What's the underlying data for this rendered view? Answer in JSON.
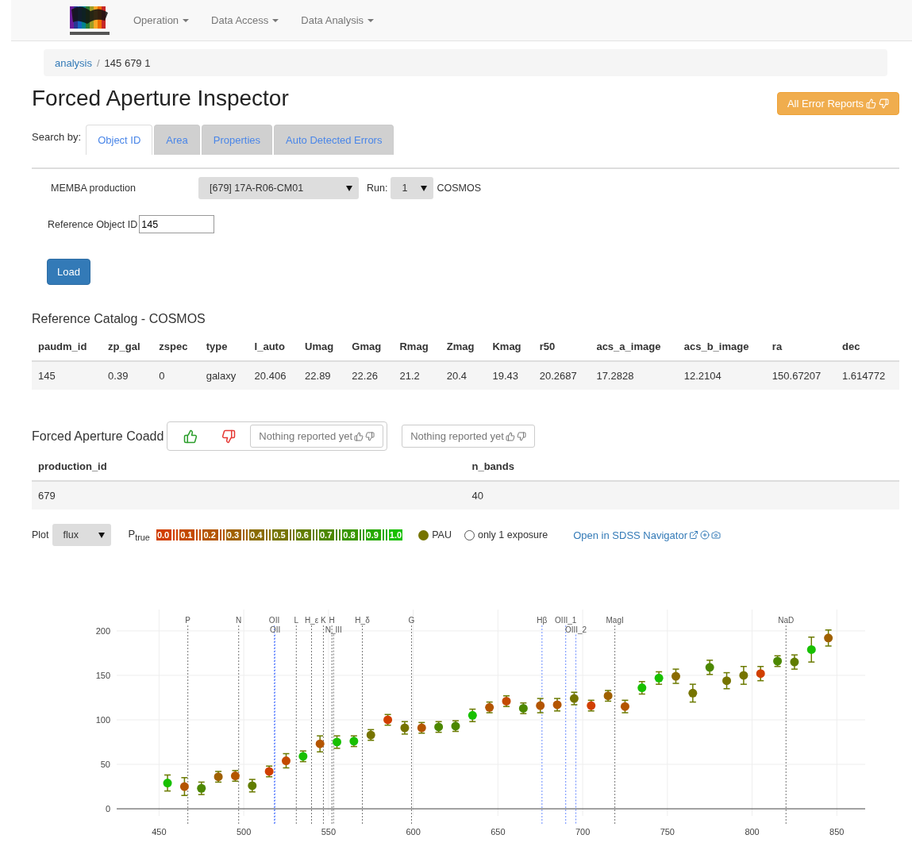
{
  "navbar": {
    "menus": [
      {
        "label": "Operation"
      },
      {
        "label": "Data Access"
      },
      {
        "label": "Data Analysis"
      }
    ]
  },
  "breadcrumb": [
    {
      "label": "analysis",
      "kind": "link",
      "separator": "/"
    },
    {
      "label": "145 679 1",
      "kind": "current"
    }
  ],
  "title": "Forced Aperture Inspector",
  "error_reports_button": "All Error Reports",
  "search": {
    "label": "Search by:",
    "tabs": [
      {
        "label": "Object ID",
        "selected": true
      },
      {
        "label": "Area",
        "selected": false
      },
      {
        "label": "Properties",
        "selected": false
      },
      {
        "label": "Auto Detected Errors",
        "selected": false
      }
    ]
  },
  "form": {
    "production_label": "MEMBA production",
    "production_value": "[679] 17A-R06-CM01",
    "run_label": "Run:",
    "run_value": "1",
    "catalog": "COSMOS",
    "ref_label": "Reference Object ID",
    "ref_value": "145",
    "load": "Load"
  },
  "reference_catalog": {
    "title": "Reference Catalog - COSMOS",
    "columns": [
      "paudm_id",
      "zp_gal",
      "zspec",
      "type",
      "I_auto",
      "Umag",
      "Gmag",
      "Rmag",
      "Zmag",
      "Kmag",
      "r50",
      "acs_a_image",
      "acs_b_image",
      "ra",
      "dec"
    ],
    "rows": [
      [
        "145",
        "0.39",
        "0",
        "galaxy",
        "20.406",
        "22.89",
        "22.26",
        "21.2",
        "20.4",
        "19.43",
        "20.2687",
        "17.2828",
        "12.2104",
        "150.67207",
        "1.614772"
      ]
    ]
  },
  "coadd": {
    "title": "Forced Aperture Coadd",
    "feedback": [
      "Nothing reported yet",
      "Nothing reported yet"
    ],
    "columns": [
      "production_id",
      "n_bands"
    ],
    "rows": [
      [
        "679",
        "40"
      ]
    ]
  },
  "plot_controls": {
    "label": "Plot",
    "value": "flux",
    "p_label": "P$_{true}$",
    "legend": {
      "label": "PAU",
      "color": "#767400"
    },
    "exposure": {
      "label": "only 1 exposure",
      "checked": false
    },
    "link": "Open in SDSS Navigator"
  },
  "chart_data": {
    "type": "scatter",
    "grid": true,
    "xlim": [
      425,
      870
    ],
    "ylim": [
      -8,
      224
    ],
    "xticks": [
      450,
      500,
      550,
      600,
      650,
      700,
      750,
      800,
      850
    ],
    "yticks": [
      0,
      50,
      100,
      150,
      200
    ],
    "x": [
      455,
      465,
      475,
      485,
      495,
      505,
      515,
      525,
      535,
      545,
      555,
      565,
      575,
      585,
      595,
      605,
      615,
      625,
      635,
      645,
      655,
      665,
      675,
      685,
      695,
      705,
      715,
      725,
      735,
      745,
      755,
      765,
      775,
      785,
      795,
      805,
      815,
      825,
      835,
      845
    ],
    "series": [
      {
        "name": "0.0",
        "color": "#d13f00",
        "values": [
          null,
          null,
          null,
          null,
          null,
          null,
          42,
          null,
          null,
          null,
          null,
          null,
          null,
          100,
          null,
          null,
          null,
          null,
          null,
          null,
          null,
          null,
          null,
          null,
          null,
          116,
          null,
          null,
          null,
          null,
          null,
          null,
          null,
          null,
          null,
          152,
          null,
          null,
          null,
          null
        ],
        "errors": [
          null,
          null,
          null,
          null,
          null,
          null,
          6,
          null,
          null,
          null,
          null,
          null,
          null,
          6,
          null,
          null,
          null,
          null,
          null,
          null,
          null,
          null,
          null,
          null,
          null,
          6,
          null,
          null,
          null,
          null,
          null,
          null,
          null,
          null,
          null,
          8,
          null,
          null,
          null,
          null
        ]
      },
      {
        "name": "0.1",
        "color": "#c44a00",
        "values": [
          null,
          null,
          null,
          null,
          null,
          null,
          null,
          54,
          null,
          null,
          null,
          null,
          null,
          null,
          null,
          null,
          null,
          null,
          null,
          null,
          121,
          null,
          null,
          null,
          null,
          null,
          null,
          null,
          null,
          null,
          null,
          null,
          null,
          null,
          null,
          null,
          null,
          null,
          null,
          null
        ],
        "errors": [
          null,
          null,
          null,
          null,
          null,
          null,
          null,
          8,
          null,
          null,
          null,
          null,
          null,
          null,
          null,
          null,
          null,
          null,
          null,
          null,
          6,
          null,
          null,
          null,
          null,
          null,
          null,
          null,
          null,
          null,
          null,
          null,
          null,
          null,
          null,
          null,
          null,
          null,
          null,
          null
        ]
      },
      {
        "name": "0.2",
        "color": "#b45500",
        "values": [
          null,
          25,
          null,
          null,
          37,
          null,
          null,
          null,
          null,
          73,
          null,
          null,
          null,
          null,
          null,
          91,
          null,
          null,
          null,
          114,
          null,
          null,
          116,
          117,
          null,
          null,
          null,
          115,
          null,
          null,
          null,
          null,
          null,
          null,
          null,
          null,
          null,
          null,
          null,
          null
        ],
        "errors": [
          null,
          10,
          null,
          null,
          6,
          null,
          null,
          null,
          null,
          9,
          null,
          null,
          null,
          null,
          null,
          6,
          null,
          null,
          null,
          6,
          null,
          null,
          8,
          7,
          null,
          null,
          null,
          7,
          null,
          null,
          null,
          null,
          null,
          null,
          null,
          null,
          null,
          null,
          null,
          null
        ]
      },
      {
        "name": "0.3",
        "color": "#a06000",
        "values": [
          null,
          null,
          null,
          36,
          null,
          null,
          null,
          null,
          null,
          null,
          null,
          null,
          null,
          null,
          null,
          null,
          null,
          null,
          null,
          null,
          null,
          null,
          null,
          null,
          null,
          null,
          127,
          null,
          null,
          null,
          null,
          null,
          null,
          null,
          null,
          null,
          null,
          null,
          null,
          192
        ],
        "errors": [
          null,
          null,
          null,
          6,
          null,
          null,
          null,
          null,
          null,
          null,
          null,
          null,
          null,
          null,
          null,
          null,
          null,
          null,
          null,
          null,
          null,
          null,
          null,
          null,
          null,
          null,
          6,
          null,
          null,
          null,
          null,
          null,
          null,
          null,
          null,
          null,
          null,
          null,
          null,
          9
        ]
      },
      {
        "name": "0.4",
        "color": "#8a6b00",
        "values": [
          null,
          null,
          null,
          null,
          null,
          null,
          null,
          null,
          null,
          null,
          null,
          null,
          null,
          null,
          null,
          null,
          null,
          null,
          null,
          null,
          null,
          null,
          null,
          null,
          null,
          null,
          null,
          null,
          null,
          null,
          149,
          null,
          null,
          null,
          null,
          null,
          null,
          null,
          null,
          null
        ],
        "errors": [
          null,
          null,
          null,
          null,
          null,
          null,
          null,
          null,
          null,
          null,
          null,
          null,
          null,
          null,
          null,
          null,
          null,
          null,
          null,
          null,
          null,
          null,
          null,
          null,
          null,
          null,
          null,
          null,
          null,
          null,
          8,
          null,
          null,
          null,
          null,
          null,
          null,
          null,
          null,
          null
        ]
      },
      {
        "name": "0.5",
        "color": "#767400",
        "values": [
          null,
          null,
          null,
          null,
          null,
          null,
          null,
          null,
          null,
          null,
          null,
          null,
          83,
          null,
          91,
          null,
          null,
          null,
          null,
          null,
          null,
          null,
          null,
          null,
          124,
          null,
          null,
          null,
          null,
          null,
          null,
          130,
          null,
          144,
          150,
          null,
          null,
          null,
          null,
          null
        ],
        "errors": [
          null,
          null,
          null,
          null,
          null,
          null,
          null,
          null,
          null,
          null,
          null,
          null,
          6,
          null,
          7,
          null,
          null,
          null,
          null,
          null,
          null,
          null,
          null,
          null,
          7,
          null,
          null,
          null,
          null,
          null,
          null,
          10,
          null,
          9,
          10,
          null,
          null,
          null,
          null,
          null
        ]
      },
      {
        "name": "0.6",
        "color": "#617d00",
        "values": [
          null,
          null,
          null,
          null,
          null,
          26,
          null,
          null,
          null,
          null,
          null,
          null,
          null,
          null,
          null,
          null,
          null,
          null,
          null,
          null,
          null,
          null,
          null,
          null,
          null,
          null,
          null,
          null,
          null,
          null,
          null,
          null,
          null,
          null,
          null,
          null,
          null,
          165,
          null,
          null
        ],
        "errors": [
          null,
          null,
          null,
          null,
          null,
          7,
          null,
          null,
          null,
          null,
          null,
          null,
          null,
          null,
          null,
          null,
          null,
          null,
          null,
          null,
          null,
          null,
          null,
          null,
          null,
          null,
          null,
          null,
          null,
          null,
          null,
          null,
          null,
          null,
          null,
          null,
          null,
          8,
          null,
          null
        ]
      },
      {
        "name": "0.7",
        "color": "#4c8800",
        "values": [
          null,
          null,
          23,
          null,
          null,
          null,
          null,
          null,
          null,
          null,
          null,
          null,
          null,
          null,
          null,
          null,
          92,
          93,
          null,
          null,
          null,
          113,
          null,
          null,
          null,
          null,
          null,
          null,
          null,
          null,
          null,
          null,
          159,
          null,
          null,
          null,
          166,
          null,
          null,
          null
        ],
        "errors": [
          null,
          null,
          7,
          null,
          null,
          null,
          null,
          null,
          null,
          null,
          null,
          null,
          null,
          null,
          null,
          null,
          6,
          6,
          null,
          null,
          null,
          6,
          null,
          null,
          null,
          null,
          null,
          null,
          null,
          null,
          null,
          null,
          8,
          null,
          null,
          null,
          6,
          null,
          null,
          null
        ]
      },
      {
        "name": "0.8",
        "color": "#389600",
        "values": [
          null,
          null,
          null,
          null,
          null,
          null,
          null,
          null,
          null,
          null,
          null,
          null,
          null,
          null,
          null,
          null,
          null,
          null,
          null,
          null,
          null,
          null,
          null,
          null,
          null,
          null,
          null,
          null,
          null,
          null,
          null,
          null,
          null,
          null,
          null,
          null,
          null,
          null,
          null,
          null
        ]
      },
      {
        "name": "0.9",
        "color": "#26a800",
        "values": [
          null,
          null,
          null,
          null,
          null,
          null,
          null,
          null,
          null,
          null,
          null,
          null,
          null,
          null,
          null,
          null,
          null,
          null,
          null,
          null,
          null,
          null,
          null,
          null,
          null,
          null,
          null,
          null,
          null,
          null,
          null,
          null,
          null,
          null,
          null,
          null,
          null,
          null,
          null,
          null
        ]
      },
      {
        "name": "1.0",
        "color": "#18c000",
        "values": [
          29,
          null,
          null,
          null,
          null,
          null,
          null,
          null,
          59,
          null,
          75,
          76,
          null,
          null,
          null,
          null,
          null,
          null,
          105,
          null,
          null,
          null,
          null,
          null,
          null,
          null,
          null,
          null,
          136,
          147,
          null,
          null,
          null,
          null,
          null,
          null,
          null,
          null,
          179,
          null
        ],
        "errors": [
          9,
          null,
          null,
          null,
          null,
          null,
          null,
          null,
          6,
          null,
          7,
          6,
          null,
          null,
          null,
          null,
          null,
          null,
          7,
          null,
          null,
          null,
          null,
          null,
          null,
          null,
          null,
          null,
          7,
          7,
          null,
          null,
          null,
          null,
          null,
          null,
          null,
          null,
          14,
          null
        ]
      }
    ],
    "ref_lines": [
      {
        "axis": "x",
        "value": 467,
        "label": "P",
        "color": "#777777"
      },
      {
        "axis": "x",
        "value": 497,
        "label": "N",
        "color": "#777777"
      },
      {
        "axis": "x",
        "value": 518,
        "label": "OII",
        "color": "#6b8cff"
      },
      {
        "axis": "x",
        "value": 518.5,
        "label": "OII",
        "color": "#6b8cff"
      },
      {
        "axis": "x",
        "value": 531,
        "label": "L",
        "color": "#777777"
      },
      {
        "axis": "x",
        "value": 540,
        "label": "H_ε",
        "color": "#777777"
      },
      {
        "axis": "x",
        "value": 547,
        "label": "K",
        "color": "#777777"
      },
      {
        "axis": "x",
        "value": 552,
        "label": "H",
        "color": "#777777"
      },
      {
        "axis": "x",
        "value": 553,
        "label": "N_III",
        "color": "#777777"
      },
      {
        "axis": "x",
        "value": 570,
        "label": "H_δ",
        "color": "#777777"
      },
      {
        "axis": "x",
        "value": 599,
        "label": "G",
        "color": "#777777"
      },
      {
        "axis": "x",
        "value": 676,
        "label": "Hβ",
        "color": "#6b8cff"
      },
      {
        "axis": "x",
        "value": 690,
        "label": "OIII_1",
        "color": "#6b8cff"
      },
      {
        "axis": "x",
        "value": 696,
        "label": "OIII_2",
        "color": "#6b8cff"
      },
      {
        "axis": "x",
        "value": 719,
        "label": "MagI",
        "color": "#777777"
      },
      {
        "axis": "x",
        "value": 820,
        "label": "NaD",
        "color": "#777777"
      }
    ]
  }
}
